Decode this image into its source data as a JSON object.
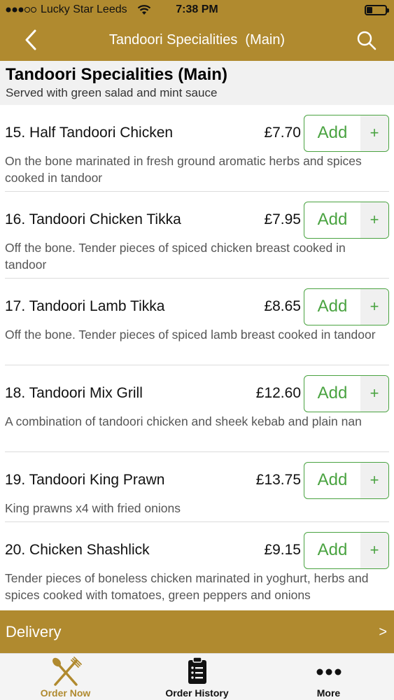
{
  "status_bar": {
    "carrier": "Lucky Star Leeds",
    "time": "7:38 PM"
  },
  "nav": {
    "title": "Tandoori Specialities  (Main)"
  },
  "section": {
    "title": "Tandoori Specialities (Main)",
    "subtitle": "Served with green salad and mint sauce"
  },
  "add_label": "Add",
  "plus_label": "+",
  "items": [
    {
      "name": "15. Half Tandoori Chicken",
      "price": "£7.70",
      "desc": "On the bone marinated in fresh ground aromatic herbs and spices cooked in tandoor"
    },
    {
      "name": "16. Tandoori Chicken Tikka",
      "price": "£7.95",
      "desc": "Off the bone. Tender pieces of spiced chicken breast cooked in tandoor"
    },
    {
      "name": "17. Tandoori Lamb Tikka",
      "price": "£8.65",
      "desc": "Off the bone. Tender pieces of spiced lamb breast cooked in tandoor"
    },
    {
      "name": "18. Tandoori Mix Grill",
      "price": "£12.60",
      "desc": "A combination of tandoori chicken and sheek kebab and plain nan"
    },
    {
      "name": "19. Tandoori King Prawn",
      "price": "£13.75",
      "desc": "King prawns x4 with fried onions"
    },
    {
      "name": "20. Chicken Shashlick",
      "price": "£9.15",
      "desc": "Tender pieces of boneless chicken marinated in yoghurt, herbs and spices cooked with tomatoes, green peppers and onions"
    }
  ],
  "delivery": {
    "label": "Delivery",
    "arrow": ">"
  },
  "tabs": [
    {
      "label": "Order Now",
      "icon": "fork-knife-icon",
      "active": true
    },
    {
      "label": "Order History",
      "icon": "clipboard-icon",
      "active": false
    },
    {
      "label": "More",
      "icon": "more-dots-icon",
      "active": false
    }
  ],
  "colors": {
    "brand": "#b08a2f",
    "accent_green": "#4aa341",
    "header_bg": "#f1f1f1"
  }
}
